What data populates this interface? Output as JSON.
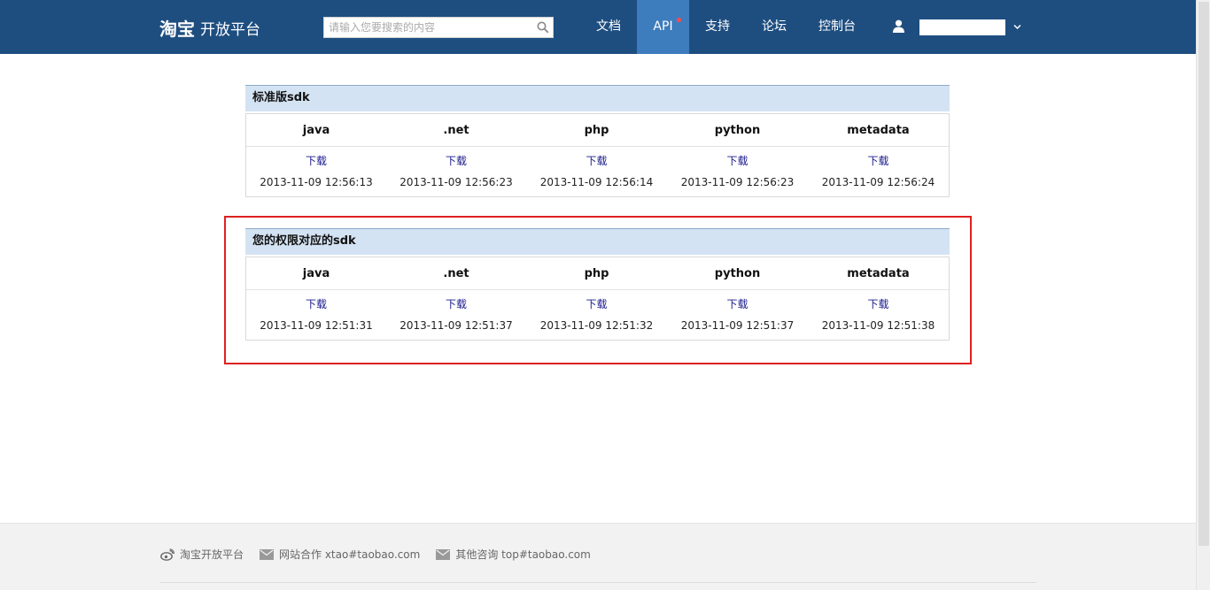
{
  "header": {
    "logo_brand": "淘宝",
    "logo_sub": "开放平台",
    "search_placeholder": "请输入您要搜索的内容",
    "nav": [
      {
        "label": "文档",
        "active": false
      },
      {
        "label": "API",
        "active": true,
        "badge": true
      },
      {
        "label": "支持",
        "active": false
      },
      {
        "label": "论坛",
        "active": false
      },
      {
        "label": "控制台",
        "active": false
      }
    ]
  },
  "sections": [
    {
      "title": "标准版sdk",
      "columns": [
        "java",
        ".net",
        "php",
        "python",
        "metadata"
      ],
      "download_label": "下载",
      "timestamps": [
        "2013-11-09 12:56:13",
        "2013-11-09 12:56:23",
        "2013-11-09 12:56:14",
        "2013-11-09 12:56:23",
        "2013-11-09 12:56:24"
      ]
    },
    {
      "title": "您的权限对应的sdk",
      "columns": [
        "java",
        ".net",
        "php",
        "python",
        "metadata"
      ],
      "download_label": "下载",
      "timestamps": [
        "2013-11-09 12:51:31",
        "2013-11-09 12:51:37",
        "2013-11-09 12:51:32",
        "2013-11-09 12:51:37",
        "2013-11-09 12:51:38"
      ]
    }
  ],
  "footer": {
    "items": [
      {
        "label": "淘宝开放平台",
        "icon": "weibo-icon"
      },
      {
        "label": "网站合作 xtao#taobao.com",
        "icon": "mail-icon"
      },
      {
        "label": "其他咨询 top#taobao.com",
        "icon": "mail-icon"
      }
    ]
  },
  "colors": {
    "header_bg": "#1e4e80",
    "nav_active_bg": "#3d7cbd",
    "section_title_bg": "#d4e3f3",
    "highlight_border": "#e02020",
    "link": "#1a1a8c"
  }
}
